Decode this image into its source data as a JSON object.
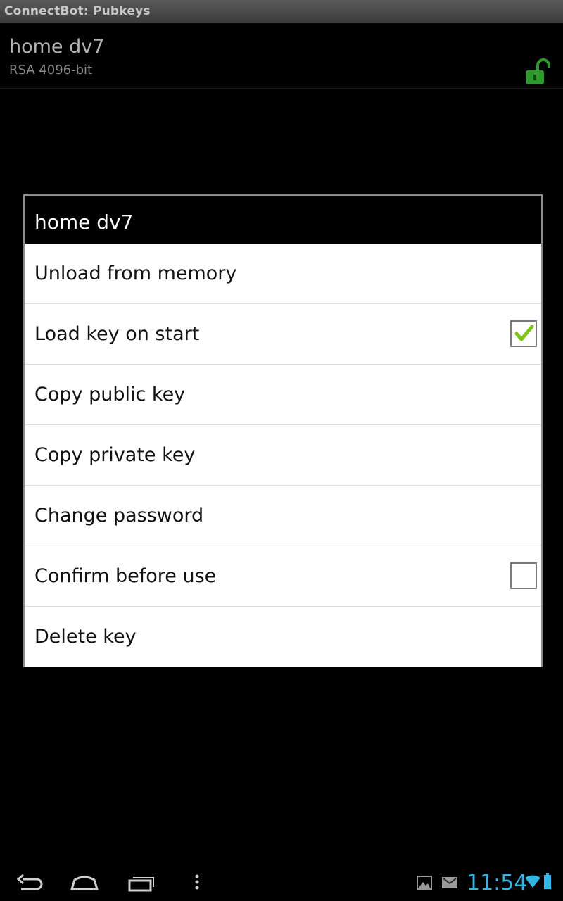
{
  "app": {
    "window_title": "ConnectBot: Pubkeys"
  },
  "key_entry": {
    "name": "home dv7",
    "type": "RSA 4096-bit",
    "lock_icon": "unlocked-padlock-icon",
    "lock_color": "#2e9a2e"
  },
  "dialog": {
    "title": "home dv7",
    "items": [
      {
        "label": "Unload from memory"
      },
      {
        "label": "Load key on start",
        "checked": true
      },
      {
        "label": "Copy public key"
      },
      {
        "label": "Copy private key"
      },
      {
        "label": "Change password"
      },
      {
        "label": "Confirm before use",
        "checked": false
      },
      {
        "label": "Delete key"
      }
    ]
  },
  "system_bar": {
    "time": "11:54",
    "accent": "#33b5e5",
    "nav_icons": [
      "back-icon",
      "home-icon",
      "recent-apps-icon",
      "menu-icon"
    ],
    "status_icons": [
      "gallery-notification-icon",
      "gmail-notification-icon",
      "wifi-icon",
      "battery-icon"
    ]
  }
}
